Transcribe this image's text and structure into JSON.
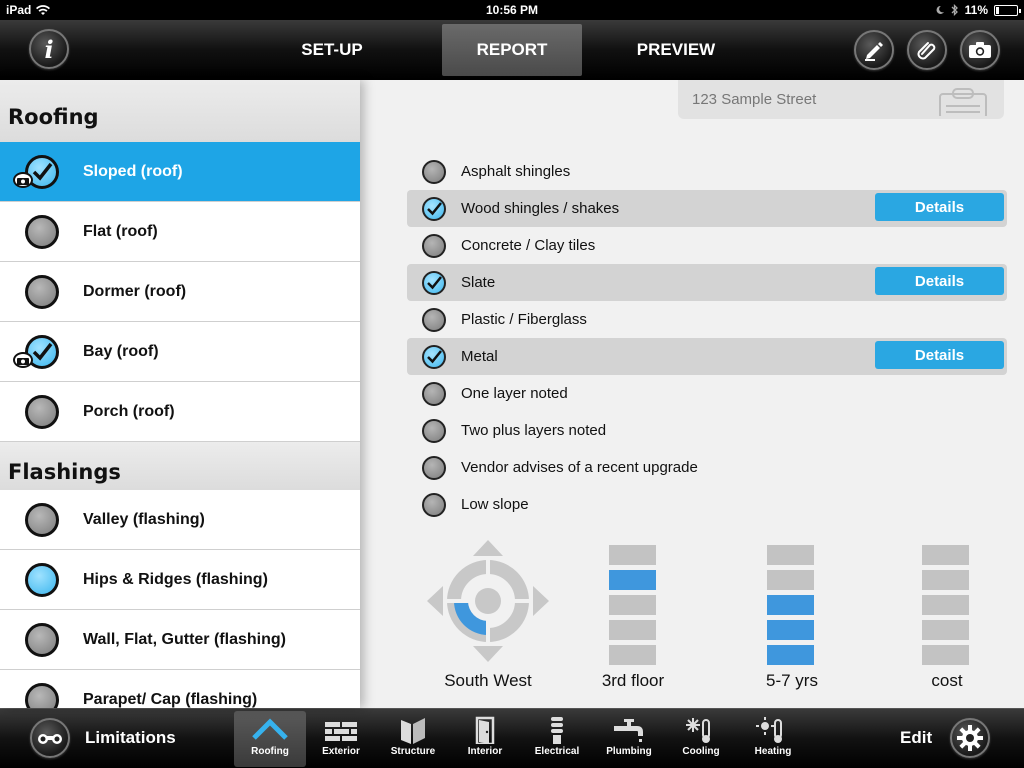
{
  "status": {
    "device": "iPad",
    "time": "10:56 PM",
    "battery": "11%",
    "battery_level": 0.11
  },
  "topbar": {
    "info_icon": "info-icon",
    "tabs": [
      {
        "label": "SET-UP",
        "active": false
      },
      {
        "label": "REPORT",
        "active": true
      },
      {
        "label": "PREVIEW",
        "active": false
      }
    ],
    "right_icons": [
      "pencil-icon",
      "paperclip-icon",
      "camera-icon"
    ]
  },
  "left": {
    "sections": [
      {
        "title": "Roofing",
        "items": [
          {
            "label": "Sloped (roof)",
            "state": "checked",
            "photo": true,
            "selected": true
          },
          {
            "label": "Flat (roof)",
            "state": "off",
            "photo": false,
            "selected": false
          },
          {
            "label": "Dormer (roof)",
            "state": "off",
            "photo": false,
            "selected": false
          },
          {
            "label": "Bay (roof)",
            "state": "checked",
            "photo": true,
            "selected": false
          },
          {
            "label": "Porch (roof)",
            "state": "off",
            "photo": false,
            "selected": false
          }
        ]
      },
      {
        "title": "Flashings",
        "items": [
          {
            "label": "Valley (flashing)",
            "state": "off",
            "photo": false,
            "selected": false
          },
          {
            "label": "Hips & Ridges (flashing)",
            "state": "blue",
            "photo": false,
            "selected": false
          },
          {
            "label": "Wall, Flat, Gutter (flashing)",
            "state": "off",
            "photo": false,
            "selected": false
          },
          {
            "label": "Parapet/ Cap (flashing)",
            "state": "off",
            "photo": false,
            "selected": false
          }
        ]
      }
    ]
  },
  "right": {
    "address": "123 Sample Street",
    "options": [
      {
        "label": "Asphalt shingles",
        "checked": false
      },
      {
        "label": "Wood shingles / shakes",
        "checked": true,
        "details": "Details"
      },
      {
        "label": "Concrete / Clay tiles",
        "checked": false
      },
      {
        "label": "Slate",
        "checked": true,
        "details": "Details"
      },
      {
        "label": "Plastic / Fiberglass",
        "checked": false
      },
      {
        "label": "Metal",
        "checked": true,
        "details": "Details"
      },
      {
        "label": "One layer noted",
        "checked": false
      },
      {
        "label": "Two plus layers noted",
        "checked": false
      },
      {
        "label": "Vendor advises of a recent upgrade",
        "checked": false
      },
      {
        "label": "Low slope",
        "checked": false
      }
    ],
    "gauges": {
      "direction": {
        "label": "South West",
        "value": "SW"
      },
      "floor": {
        "label": "3rd floor",
        "segments": 5,
        "active": [
          1
        ]
      },
      "age": {
        "label": "5-7 yrs",
        "segments": 5,
        "active": [
          2,
          3,
          4
        ]
      },
      "cost": {
        "label": "cost",
        "segments": 5,
        "active": []
      }
    }
  },
  "bottombar": {
    "limitations_label": "Limitations",
    "edit_label": "Edit",
    "tabs": [
      {
        "label": "Roofing",
        "icon": "roof-icon",
        "active": true
      },
      {
        "label": "Exterior",
        "icon": "brick-icon",
        "active": false
      },
      {
        "label": "Structure",
        "icon": "structure-icon",
        "active": false
      },
      {
        "label": "Interior",
        "icon": "door-icon",
        "active": false
      },
      {
        "label": "Electrical",
        "icon": "bulb-icon",
        "active": false
      },
      {
        "label": "Plumbing",
        "icon": "faucet-icon",
        "active": false
      },
      {
        "label": "Cooling",
        "icon": "snowflake-thermometer-icon",
        "active": false
      },
      {
        "label": "Heating",
        "icon": "sun-thermometer-icon",
        "active": false
      }
    ]
  },
  "colors": {
    "accent": "#1ea5e6",
    "details": "#2aa7e2",
    "gauge_active": "#3f97dd"
  }
}
